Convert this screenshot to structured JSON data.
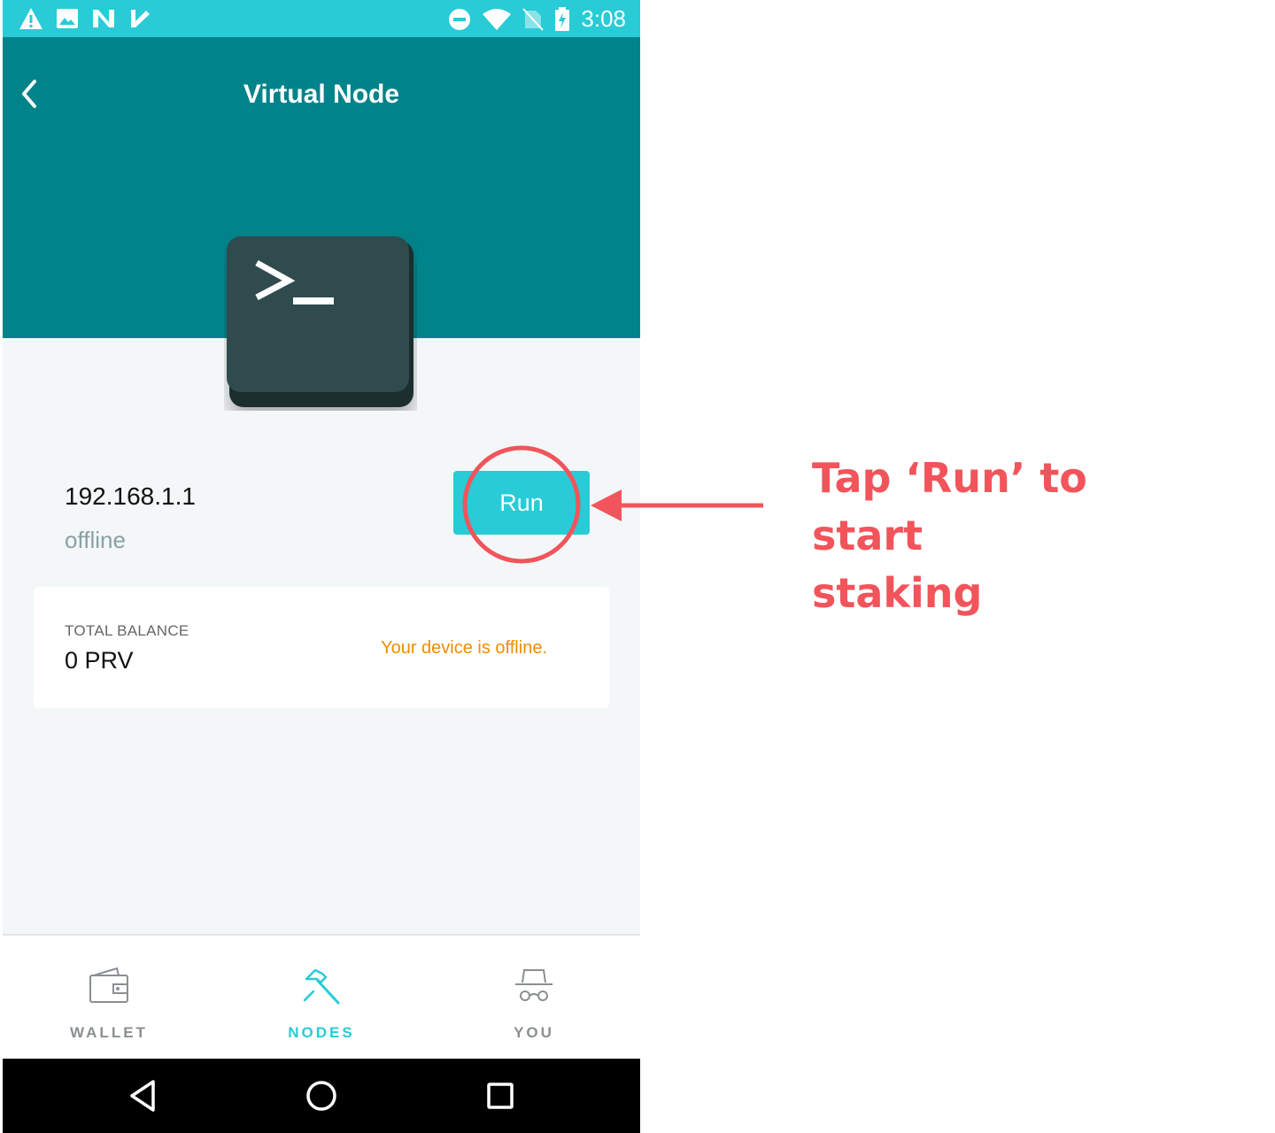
{
  "status_bar": {
    "time": "3:08",
    "left_icons": [
      "warning-icon",
      "image-icon",
      "n-logo-icon",
      "check-flag-icon"
    ],
    "right_icons": [
      "do-not-disturb-icon",
      "wifi-icon",
      "no-signal-icon",
      "battery-charging-icon"
    ]
  },
  "header": {
    "title": "Virtual Node",
    "back_icon": "chevron-left-icon",
    "color": "#01838a"
  },
  "node": {
    "ip": "192.168.1.1",
    "status": "offline",
    "run_label": "Run"
  },
  "balance_card": {
    "label": "TOTAL BALANCE",
    "value": "0 PRV",
    "warning": "Your device is offline."
  },
  "tabs": [
    {
      "label": "WALLET",
      "icon": "wallet-icon",
      "active": false
    },
    {
      "label": "NODES",
      "icon": "hammer-icon",
      "active": true
    },
    {
      "label": "YOU",
      "icon": "incognito-icon",
      "active": false
    }
  ],
  "nav_buttons": [
    "back-triangle-icon",
    "home-circle-icon",
    "recents-square-icon"
  ],
  "annotation": {
    "line1": "Tap ‘Run’ to start",
    "line2": "staking",
    "color": "#f2545b"
  },
  "colors": {
    "accent": "#28cbd6",
    "warning": "#f08c00"
  }
}
